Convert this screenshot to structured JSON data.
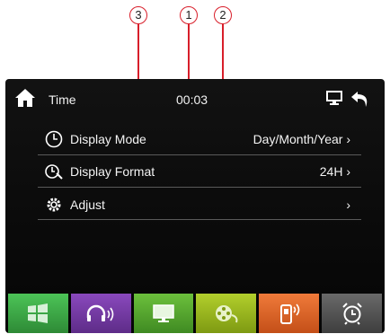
{
  "callouts": [
    "3",
    "1",
    "2"
  ],
  "header": {
    "title": "Time",
    "clock": "00:03"
  },
  "rows": [
    {
      "label": "Display Mode",
      "value": "Day/Month/Year",
      "arrow": "›",
      "icon": "clock-icon"
    },
    {
      "label": "Display Format",
      "value": "24H",
      "arrow": "›",
      "icon": "clock-key-icon"
    },
    {
      "label": "Adjust",
      "value": "",
      "arrow": "›",
      "icon": "gear-icon"
    }
  ],
  "dock": [
    {
      "name": "windows-app",
      "color": "#3fae48",
      "icon": "windows-icon"
    },
    {
      "name": "music-app",
      "color": "#7a3aa8",
      "icon": "headphones-icon"
    },
    {
      "name": "display-app",
      "color": "#5aa832",
      "icon": "monitor-icon"
    },
    {
      "name": "video-app",
      "color": "#9bbb1e",
      "icon": "film-reel-icon"
    },
    {
      "name": "bluetooth-phone-app",
      "color": "#e2662a",
      "icon": "phone-icon"
    },
    {
      "name": "clock-app",
      "color": "#5a5a5a",
      "icon": "alarm-clock-icon"
    }
  ],
  "colors": {
    "callout_red": "#d81e2a",
    "screen_bg": "#0b0b0b"
  }
}
